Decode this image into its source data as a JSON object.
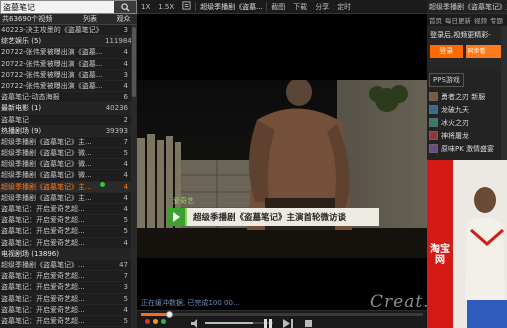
{
  "search": {
    "value": "盗墓笔记"
  },
  "list_header": {
    "title": "共63690个视频",
    "col_list": "列表",
    "col_watch": "观众"
  },
  "playlist": [
    {
      "title": "40223-决主攻墨的《盗墓笔记》",
      "count": "3",
      "type": "item"
    },
    {
      "title": "综艺娱乐 (5)",
      "count": "111984",
      "type": "group"
    },
    {
      "title": "20722-张伟爱被曝出演《盗墓...",
      "count": "4",
      "type": "item"
    },
    {
      "title": "20722-张伟爱被曝出演《盗墓...",
      "count": "4",
      "type": "item"
    },
    {
      "title": "20722-张伟爱被曝出演《盗墓...",
      "count": "3",
      "type": "item"
    },
    {
      "title": "20722-张伟爱被曝出演《盗墓...",
      "count": "4",
      "type": "item"
    },
    {
      "title": "盗墓笔记-动态海报",
      "count": "6",
      "type": "item"
    },
    {
      "title": "最新电影 (1)",
      "count": "40236",
      "type": "group"
    },
    {
      "title": "盗墓笔记",
      "count": "2",
      "type": "item"
    },
    {
      "title": "热播剧场 (9)",
      "count": "39393",
      "type": "group"
    },
    {
      "title": "超级季播剧《盗墓笔记》主...",
      "count": "7",
      "type": "item"
    },
    {
      "title": "超级季播剧《盗墓笔记》微...",
      "count": "5",
      "type": "item"
    },
    {
      "title": "超级季播剧《盗墓笔记》微...",
      "count": "4",
      "type": "item"
    },
    {
      "title": "超级季播剧《盗墓笔记》微...",
      "count": "4",
      "type": "item"
    },
    {
      "title": "超级季播剧《盗墓笔记》主...",
      "count": "4",
      "type": "active"
    },
    {
      "title": "超级季播剧《盗墓笔记》主...",
      "count": "4",
      "type": "item"
    },
    {
      "title": "盗墓笔记：开启爱奇艺超...",
      "count": "4",
      "type": "item"
    },
    {
      "title": "盗墓笔记：开启爱奇艺超...",
      "count": "5",
      "type": "item"
    },
    {
      "title": "盗墓笔记：开启爱奇艺超...",
      "count": "5",
      "type": "item"
    },
    {
      "title": "盗墓笔记：开启爱奇艺超...",
      "count": "4",
      "type": "item"
    },
    {
      "title": "电视剧场 (13896)",
      "count": "",
      "type": "group"
    },
    {
      "title": "超级季播剧《盗墓笔记》...",
      "count": "47",
      "type": "item"
    },
    {
      "title": "盗墓笔记：开启爱奇艺超...",
      "count": "7",
      "type": "item"
    },
    {
      "title": "盗墓笔记：开启爱奇艺超...",
      "count": "3",
      "type": "item"
    },
    {
      "title": "盗墓笔记：开启爱奇艺超...",
      "count": "5",
      "type": "item"
    },
    {
      "title": "盗墓笔记：开启爱奇艺超...",
      "count": "4",
      "type": "item"
    },
    {
      "title": "盗墓笔记：开启爱奇艺超...",
      "count": "5",
      "type": "item"
    }
  ],
  "topbar": {
    "speed_1x": "1X",
    "speed_15x": "1.5X",
    "speed_label": "设置",
    "title": "超级季播剧《盗墓...",
    "screenshot": "截图",
    "download": "下载",
    "share": "分享",
    "timer": "定时"
  },
  "video": {
    "banner_logo": "爱奇艺",
    "banner_text": "超级季播剧《盗墓笔记》主演首轮微访谈",
    "status_text": "正在缓冲数据, 已完成100 00...",
    "watermark": "Creat...",
    "progress": 0.1,
    "volume": 0.7
  },
  "right": {
    "header": "超级季播剧《盗墓笔记》主...",
    "nav": [
      "首页",
      "每日更新",
      "视频",
      "专题"
    ],
    "login_text": "登录后,视频更精彩-",
    "login_button": "登录",
    "secondary_button": "同步看",
    "games_title": "PPS游戏",
    "games": [
      "勇者之刃 新服",
      "龙破九天",
      "冰火之刃",
      "神将屠龙",
      "原味PK 激情盛宴"
    ],
    "ad_logo": "淘宝网"
  },
  "colors": {
    "accent": "#ff6a1a",
    "panel": "#1e1e1e",
    "green_dot": "#36c23a"
  }
}
